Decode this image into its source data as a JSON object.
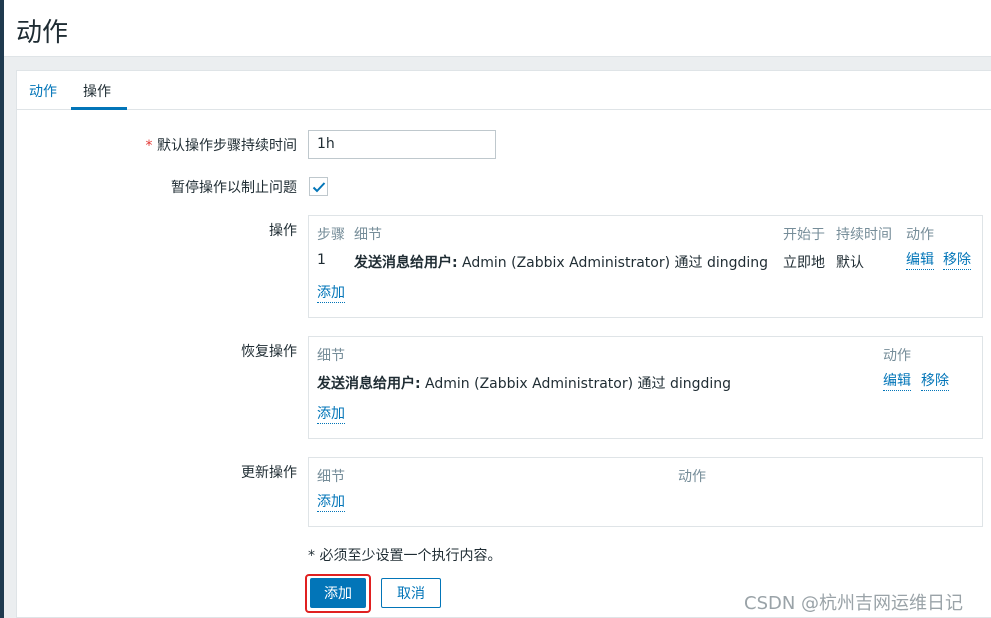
{
  "page": {
    "title": "动作"
  },
  "tabs": [
    {
      "label": "动作",
      "active": false
    },
    {
      "label": "操作",
      "active": true
    }
  ],
  "form": {
    "required_mark": "*",
    "duration_label": "默认操作步骤持续时间",
    "duration_value": "1h",
    "pause_label": "暂停操作以制止问题",
    "pause_checked": true
  },
  "operations": {
    "label": "操作",
    "headers": {
      "step": "步骤",
      "details": "细节",
      "start": "开始于",
      "duration": "持续时间",
      "action": "动作"
    },
    "rows": [
      {
        "step": "1",
        "details_bold": "发送消息给用户:",
        "details_rest": " Admin (Zabbix Administrator) 通过 dingding",
        "start": "立即地",
        "duration": "默认",
        "edit": "编辑",
        "remove": "移除"
      }
    ],
    "add_link": "添加"
  },
  "recovery": {
    "label": "恢复操作",
    "headers": {
      "details": "细节",
      "action": "动作"
    },
    "rows": [
      {
        "details_bold": "发送消息给用户:",
        "details_rest": " Admin (Zabbix Administrator) 通过 dingding",
        "edit": "编辑",
        "remove": "移除"
      }
    ],
    "add_link": "添加"
  },
  "update": {
    "label": "更新操作",
    "headers": {
      "details": "细节",
      "action": "动作"
    },
    "add_link": "添加"
  },
  "note": "* 必须至少设置一个执行内容。",
  "buttons": {
    "add": "添加",
    "cancel": "取消"
  },
  "watermark": "CSDN @杭州吉网运维日记",
  "colors": {
    "accent": "#0275b8",
    "highlight": "#e02020",
    "required": "#e33734"
  }
}
